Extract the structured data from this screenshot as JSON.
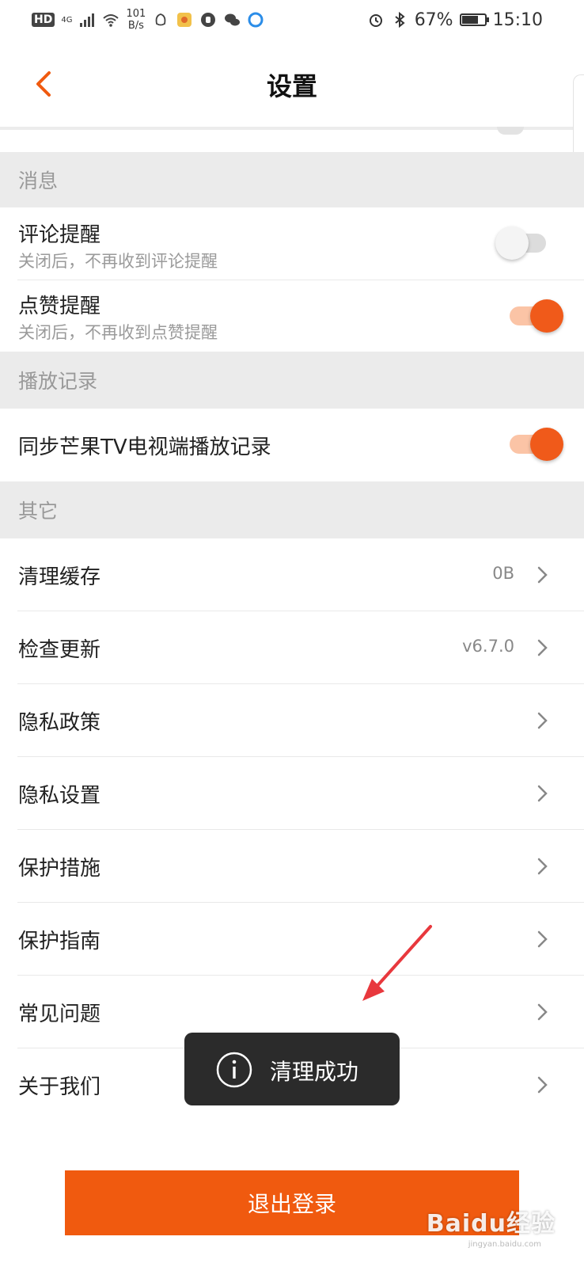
{
  "status_bar": {
    "hd": "HD",
    "network": "4G",
    "speed_value": "101",
    "speed_unit": "B/s",
    "battery": "67%",
    "time": "15:10"
  },
  "header": {
    "title": "设置"
  },
  "sections": {
    "messages": {
      "title": "消息",
      "comment": {
        "label": "评论提醒",
        "desc": "关闭后，不再收到评论提醒",
        "enabled": false
      },
      "like": {
        "label": "点赞提醒",
        "desc": "关闭后，不再收到点赞提醒",
        "enabled": true
      }
    },
    "playback": {
      "title": "播放记录",
      "sync": {
        "label": "同步芒果TV电视端播放记录",
        "enabled": true
      }
    },
    "other": {
      "title": "其它",
      "items": [
        {
          "label": "清理缓存",
          "value": "0B"
        },
        {
          "label": "检查更新",
          "value": "v6.7.0"
        },
        {
          "label": "隐私政策",
          "value": ""
        },
        {
          "label": "隐私设置",
          "value": ""
        },
        {
          "label": "保护措施",
          "value": ""
        },
        {
          "label": "保护指南",
          "value": ""
        },
        {
          "label": "常见问题",
          "value": ""
        },
        {
          "label": "关于我们",
          "value": ""
        }
      ]
    }
  },
  "toast": {
    "text": "清理成功",
    "icon": "info-icon"
  },
  "logout_label": "退出登录",
  "watermark": {
    "brand": "Baidu经验",
    "url": "jingyan.baidu.com"
  },
  "colors": {
    "accent": "#f05a0f",
    "annotation": "#e8383d"
  }
}
